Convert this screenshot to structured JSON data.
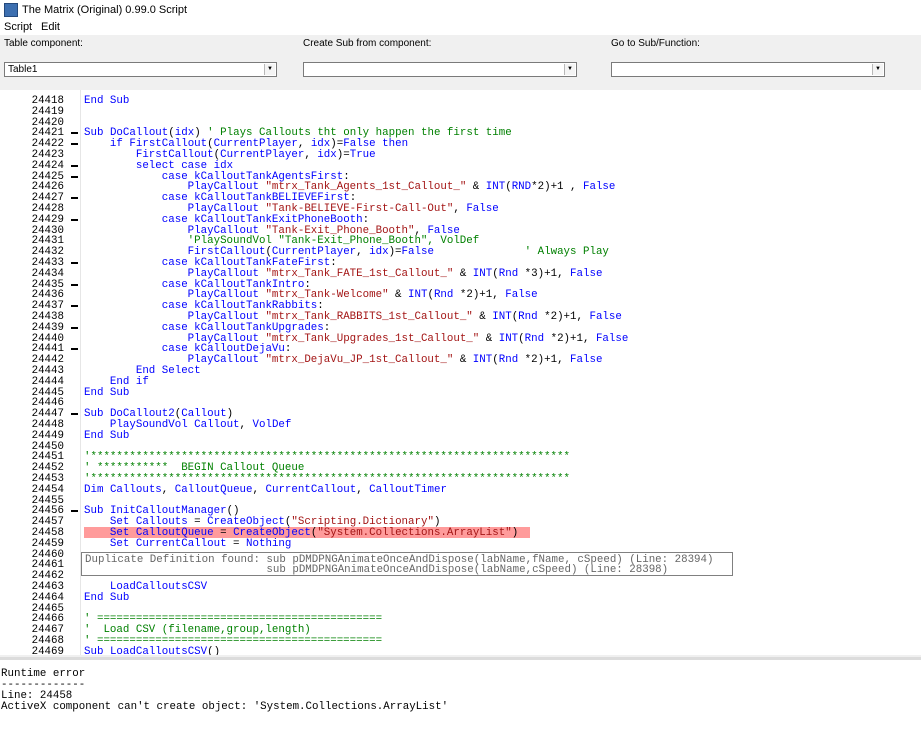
{
  "window": {
    "title": "The Matrix (Original) 0.99.0 Script"
  },
  "menu": {
    "items": [
      "Script",
      "Edit"
    ]
  },
  "toolbar": {
    "table_component_label": "Table component:",
    "table_component_value": "Table1",
    "create_sub_label": "Create Sub from component:",
    "create_sub_value": "",
    "goto_sub_label": "Go to Sub/Function:",
    "goto_sub_value": ""
  },
  "editor": {
    "current_line": 24458,
    "folded_lines": [
      24421,
      24422,
      24424,
      24425,
      24427,
      24429,
      24433,
      24435,
      24437,
      24439,
      24441,
      24447,
      24456
    ],
    "lines": [
      {
        "n": "24418",
        "code": "End Sub"
      },
      {
        "n": "24419",
        "code": ""
      },
      {
        "n": "24420",
        "code": ""
      },
      {
        "n": "24421",
        "code": "Sub DoCallout(idx) ' Plays Callouts tht only happen the first time"
      },
      {
        "n": "24422",
        "code": "    if FirstCallout(CurrentPlayer, idx)=False then"
      },
      {
        "n": "24423",
        "code": "        FirstCallout(CurrentPlayer, idx)=True"
      },
      {
        "n": "24424",
        "code": "        select case idx"
      },
      {
        "n": "24425",
        "code": "            case kCalloutTankAgentsFirst:"
      },
      {
        "n": "24426",
        "code": "                PlayCallout \"mtrx_Tank_Agents_1st_Callout_\" & INT(RND*2)+1 , False"
      },
      {
        "n": "24427",
        "code": "            case kCalloutTankBELIEVEFirst:"
      },
      {
        "n": "24428",
        "code": "                PlayCallout \"Tank-BELIEVE-First-Call-Out\", False"
      },
      {
        "n": "24429",
        "code": "            case kCalloutTankExitPhoneBooth:"
      },
      {
        "n": "24430",
        "code": "                PlayCallout \"Tank-Exit_Phone_Booth\", False"
      },
      {
        "n": "24431",
        "code": "                'PlaySoundVol \"Tank-Exit_Phone_Booth\", VolDef"
      },
      {
        "n": "24432",
        "code": "                FirstCallout(CurrentPlayer, idx)=False              ' Always Play"
      },
      {
        "n": "24433",
        "code": "            case kCalloutTankFateFirst:"
      },
      {
        "n": "24434",
        "code": "                PlayCallout \"mtrx_Tank_FATE_1st_Callout_\" & INT(Rnd *3)+1, False"
      },
      {
        "n": "24435",
        "code": "            case kCalloutTankIntro:"
      },
      {
        "n": "24436",
        "code": "                PlayCallout \"mtrx_Tank-Welcome\" & INT(Rnd *2)+1, False"
      },
      {
        "n": "24437",
        "code": "            case kCalloutTankRabbits:"
      },
      {
        "n": "24438",
        "code": "                PlayCallout \"mtrx_Tank_RABBITS_1st_Callout_\" & INT(Rnd *2)+1, False"
      },
      {
        "n": "24439",
        "code": "            case kCalloutTankUpgrades:"
      },
      {
        "n": "24440",
        "code": "                PlayCallout \"mtrx_Tank_Upgrades_1st_Callout_\" & INT(Rnd *2)+1, False"
      },
      {
        "n": "24441",
        "code": "            case kCalloutDejaVu:"
      },
      {
        "n": "24442",
        "code": "                PlayCallout \"mtrx_DejaVu_JP_1st_Callout_\" & INT(Rnd *2)+1, False"
      },
      {
        "n": "24443",
        "code": "        End Select"
      },
      {
        "n": "24444",
        "code": "    End if"
      },
      {
        "n": "24445",
        "code": "End Sub"
      },
      {
        "n": "24446",
        "code": ""
      },
      {
        "n": "24447",
        "code": "Sub DoCallout2(Callout)"
      },
      {
        "n": "24448",
        "code": "    PlaySoundVol Callout, VolDef"
      },
      {
        "n": "24449",
        "code": "End Sub"
      },
      {
        "n": "24450",
        "code": ""
      },
      {
        "n": "24451",
        "code": "'**************************************************************************"
      },
      {
        "n": "24452",
        "code": "' ***********  BEGIN Callout Queue"
      },
      {
        "n": "24453",
        "code": "'**************************************************************************"
      },
      {
        "n": "24454",
        "code": "Dim Callouts, CalloutQueue, CurrentCallout, CalloutTimer"
      },
      {
        "n": "24455",
        "code": ""
      },
      {
        "n": "24456",
        "code": "Sub InitCalloutManager()"
      },
      {
        "n": "24457",
        "code": "    Set Callouts = CreateObject(\"Scripting.Dictionary\")"
      },
      {
        "n": "24458",
        "code": "    Set CalloutQueue = CreateObject(\"System.Collections.ArrayList\")"
      },
      {
        "n": "24459",
        "code": "    Set CurrentCallout = Nothing"
      },
      {
        "n": "24460",
        "code": ""
      },
      {
        "n": "24461",
        "code": ""
      },
      {
        "n": "24462",
        "code": ""
      },
      {
        "n": "24463",
        "code": "    LoadCalloutsCSV"
      },
      {
        "n": "24464",
        "code": "End Sub"
      },
      {
        "n": "24465",
        "code": ""
      },
      {
        "n": "24466",
        "code": "' ============================================"
      },
      {
        "n": "24467",
        "code": "'  Load CSV (filename,group,length)"
      },
      {
        "n": "24468",
        "code": "' ============================================"
      },
      {
        "n": "24469",
        "code": "Sub LoadCalloutsCSV()"
      }
    ]
  },
  "tooltip": {
    "lines": [
      "Duplicate Definition found: sub pDMDPNGAnimateOnceAndDispose(labName,fName, cSpeed) (Line: 28394)",
      "                            sub pDMDPNGAnimateOnceAndDispose(labName,cSpeed) (Line: 28398)"
    ]
  },
  "output": {
    "lines": [
      "Runtime error",
      "-------------",
      "Line: 24458",
      "ActiveX component can't create object: 'System.Collections.ArrayList'"
    ]
  }
}
